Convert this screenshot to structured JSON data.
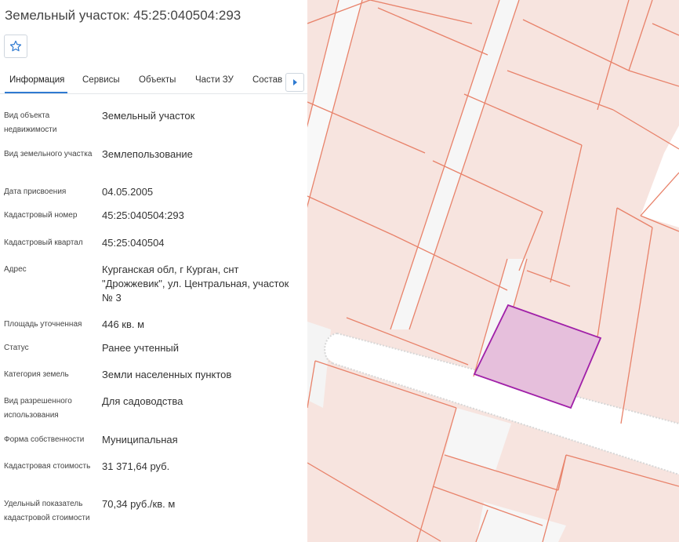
{
  "panel": {
    "title": "Земельный участок: 45:25:040504:293",
    "favorite_icon": "star-outline-icon",
    "tabs": [
      {
        "label": "Информация",
        "active": true
      },
      {
        "label": "Сервисы"
      },
      {
        "label": "Объекты"
      },
      {
        "label": "Части ЗУ"
      },
      {
        "label": "Состав"
      }
    ],
    "tabs_scroll_icon": "chevron-right-icon",
    "fields": [
      {
        "label": "Вид объекта недвижимости",
        "value": "Земельный участок"
      },
      {
        "label": "Вид земельного участка",
        "value": "Землепользование"
      },
      {
        "label": "Дата присвоения",
        "value": "04.05.2005"
      },
      {
        "label": "Кадастровый номер",
        "value": "45:25:040504:293"
      },
      {
        "label": "Кадастровый квартал",
        "value": "45:25:040504"
      },
      {
        "label": "Адрес",
        "value": "Курганская обл, г Курган, снт \"Дрожжевик\", ул. Центральная, участок № 3"
      },
      {
        "label": "Площадь уточненная",
        "value": "446 кв. м"
      },
      {
        "label": "Статус",
        "value": "Ранее учтенный"
      },
      {
        "label": "Категория земель",
        "value": "Земли населенных пунктов"
      },
      {
        "label": "Вид разрешенного использования",
        "value": "Для садоводства"
      },
      {
        "label": "Форма собственности",
        "value": "Муниципальная"
      },
      {
        "label": "Кадастровая стоимость",
        "value": "31 371,64 руб."
      },
      {
        "label": "Удельный показатель кадастровой стоимости",
        "value": "70,34 руб./кв. м"
      }
    ]
  },
  "map": {
    "parcel_fill": "#f7e4df",
    "parcel_stroke": "#e8826a",
    "selected_fill": "#e6bfdc",
    "selected_stroke": "#a020a8",
    "road_color": "#ffffff"
  },
  "colors": {
    "accent": "#2f7ad1",
    "text": "#333333"
  }
}
